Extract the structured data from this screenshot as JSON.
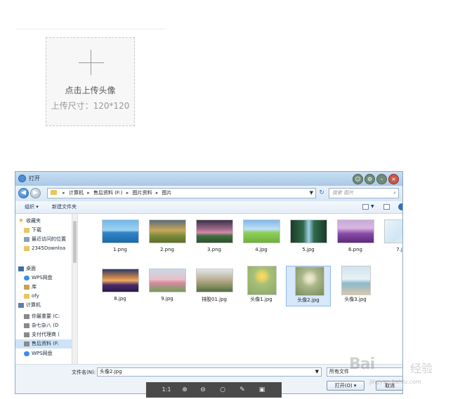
{
  "upload": {
    "label": "点击上传头像",
    "size_hint": "上传尺寸：120*120"
  },
  "dialog": {
    "title": "打开",
    "breadcrumb": [
      "计算机",
      "售后资料 (F:)",
      "图片资料",
      "图片"
    ],
    "search_placeholder": "搜索 图片",
    "toolbar": {
      "organize": "组织 ▾",
      "new_folder": "新建文件夹"
    },
    "sidebar": [
      {
        "label": "收藏夹",
        "icon": "star-icon"
      },
      {
        "label": "下载",
        "icon": "folder-icon"
      },
      {
        "label": "最近访问的位置",
        "icon": "recent-icon"
      },
      {
        "label": "2345Downloa",
        "icon": "folder-icon"
      },
      {
        "label": "桌面",
        "icon": "desktop-icon"
      },
      {
        "label": "WPS网盘",
        "icon": "cloud-icon"
      },
      {
        "label": "库",
        "icon": "library-icon"
      },
      {
        "label": "ofy",
        "icon": "folder-icon"
      },
      {
        "label": "计算机",
        "icon": "computer-icon"
      },
      {
        "label": "你最重要 (C:",
        "icon": "drive-icon"
      },
      {
        "label": "杂七杂八 (D",
        "icon": "drive-icon"
      },
      {
        "label": "支付代理商 (",
        "icon": "drive-icon"
      },
      {
        "label": "售后资料 (F:",
        "icon": "drive-icon"
      },
      {
        "label": "WPS网盘",
        "icon": "cloud-icon"
      }
    ],
    "files": [
      {
        "name": "1.png"
      },
      {
        "name": "2.png"
      },
      {
        "name": "3.png"
      },
      {
        "name": "4.jpg"
      },
      {
        "name": "5.jpg"
      },
      {
        "name": "6.png"
      },
      {
        "name": "7.jpg"
      },
      {
        "name": "8.jpg"
      },
      {
        "name": "9.jpg"
      },
      {
        "name": "排胶01.jpg"
      },
      {
        "name": "头像1.jpg"
      },
      {
        "name": "头像2.jpg",
        "selected": true
      },
      {
        "name": "头像3.jpg"
      }
    ],
    "filename_label": "文件名(N):",
    "filename_value": "头像2.jpg",
    "filetype_value": "所有文件",
    "open_button": "打开(O)",
    "cancel_button": "取消"
  },
  "viewer_bar": {
    "ratio_label": "1:1"
  },
  "watermark": {
    "brand": "Bai",
    "brand2": "经验",
    "url": "jingyan.baidu.com"
  },
  "colors": {
    "accent": "#2f70c0",
    "selection": "#d6e8fb"
  }
}
